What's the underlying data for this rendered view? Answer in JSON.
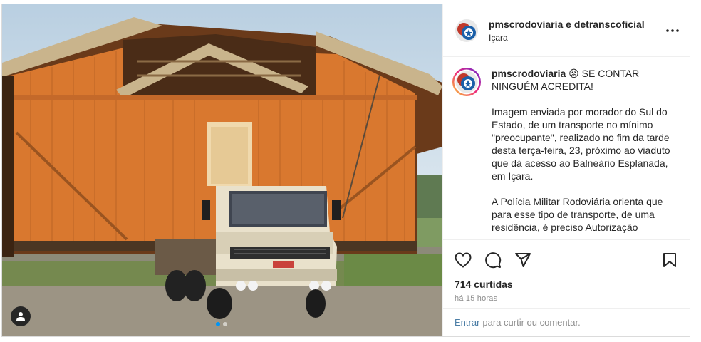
{
  "post": {
    "header": {
      "username": "pmscrodoviaria e detranscoficial",
      "location": "Içara"
    },
    "caption": {
      "username": "pmscrodoviaria",
      "emoji": "😡",
      "headline": "SE CONTAR NINGUÉM ACREDITA!",
      "paragraphs": [
        "Imagem enviada por morador do Sul do Estado, de um transporte no mínimo \"preocupante\", realizado no fim da tarde desta terça-feira, 23, próximo ao viaduto que dá acesso ao Balneário Esplanada, em Içara.",
        "A Polícia Militar Rodoviária orienta que para esse tipo de transporte, de uma residência, é preciso Autorização"
      ]
    },
    "stats": {
      "likes": "714 curtidas",
      "posted": "há 15 horas"
    },
    "comment_prompt": {
      "login_link": "Entrar",
      "rest": "para curtir ou comentar."
    },
    "carousel": {
      "slides": 2,
      "active": 1
    }
  },
  "colors": {
    "accent_link": "#4c7ea6",
    "active_dot": "#0095f6",
    "house_wood": "#d9782f",
    "text": "#262626",
    "muted": "#8e8e8e"
  },
  "icons": {
    "more": "more-horizontal-icon",
    "like": "heart-icon",
    "comment": "comment-bubble-icon",
    "share": "paper-plane-icon",
    "save": "bookmark-icon",
    "tagged": "user-silhouette-icon"
  }
}
